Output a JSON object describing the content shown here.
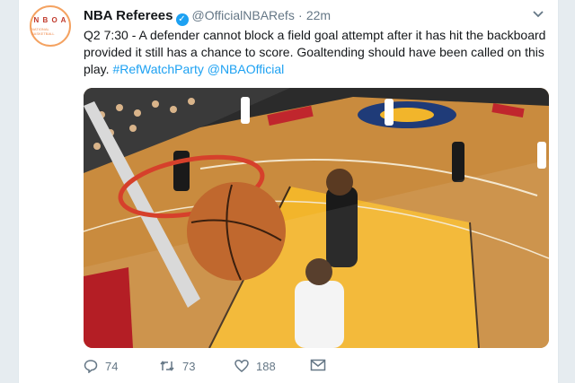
{
  "tweet": {
    "name": "NBA Referees",
    "handle": "@OfficialNBARefs",
    "separator": "·",
    "time": "22m",
    "text": "Q2 7:30 - A defender cannot block a field goal attempt after it has hit the backboard provided it still has a chance to score. Goaltending should have been called on this play.",
    "hashtags": "#RefWatchParty @NBAOfficial",
    "logo_letters": "N B O A",
    "logo_sub": "NATIONAL BASKETBALL"
  },
  "actions": {
    "replies": "74",
    "retweets": "73",
    "likes": "188"
  },
  "icons": {
    "verified": "verified-badge-icon",
    "caret": "chevron-down-icon",
    "reply": "reply-icon",
    "retweet": "retweet-icon",
    "like": "heart-icon",
    "message": "envelope-icon"
  },
  "colors": {
    "link": "#1da1f2",
    "muted": "#657786",
    "background": "#e6ecf0"
  }
}
